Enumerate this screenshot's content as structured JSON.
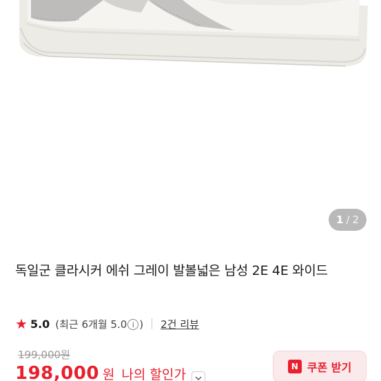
{
  "pager": {
    "current": "1",
    "separator": "/",
    "total": "2"
  },
  "product": {
    "title": "독일군 클라시커 에쉬 그레이 발볼넓은 남성 2E 4E 와이드"
  },
  "rating": {
    "star_icon": "star-icon",
    "score": "5.0",
    "recent_prefix": "(최근 6개월 5.0",
    "info_glyph": "i",
    "recent_suffix": ")",
    "review_count": "2건 리뷰"
  },
  "price": {
    "original": "199,000원",
    "sale": "198,000",
    "currency": "원",
    "discount_label": "나의 할인가",
    "chevron_icon": "chevron-down-icon"
  },
  "coupon": {
    "badge": "N",
    "label": "쿠폰 받기"
  },
  "colors": {
    "accent": "#e8202d",
    "coupon_bg": "#fbeaec"
  }
}
